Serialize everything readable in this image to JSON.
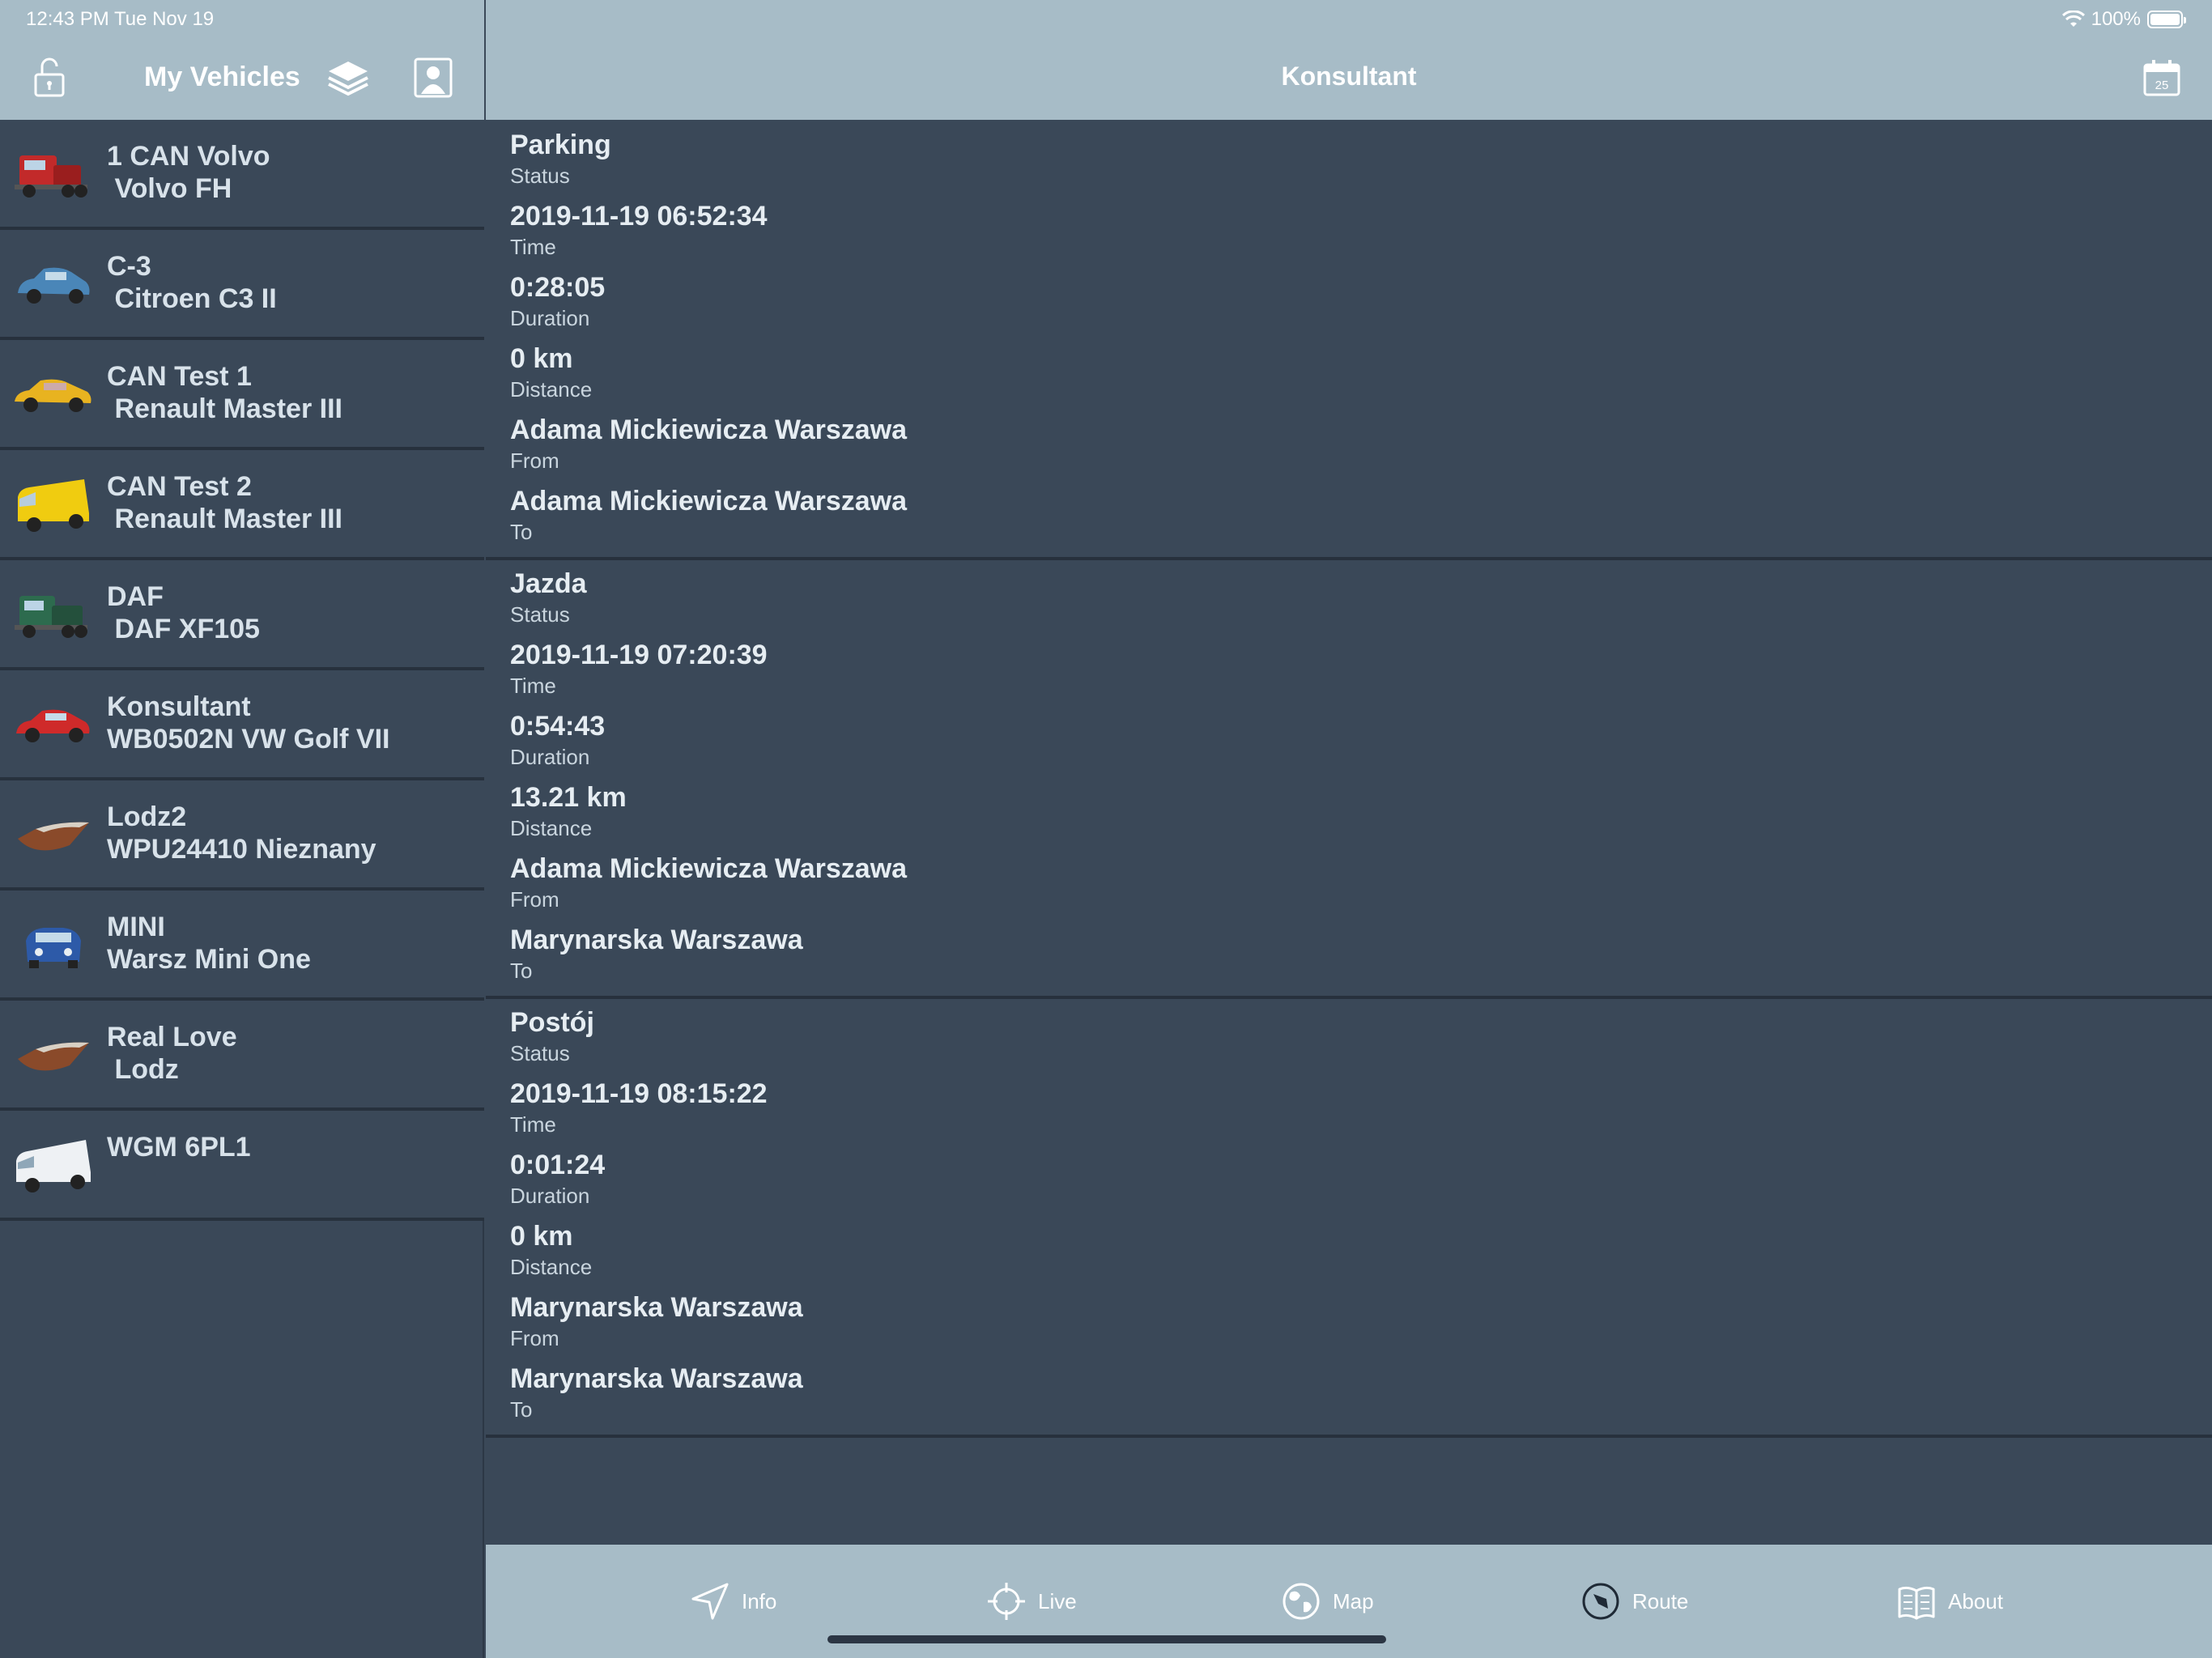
{
  "status_bar": {
    "time": "12:43 PM   Tue Nov 19",
    "battery": "100%"
  },
  "sidebar": {
    "title": "My Vehicles",
    "vehicles": [
      {
        "name": "1 CAN Volvo",
        "model": " Volvo FH",
        "icon": "red-truck-icon"
      },
      {
        "name": "C-3",
        "model": " Citroen C3 II",
        "icon": "blue-car-icon"
      },
      {
        "name": "CAN Test 1",
        "model": " Renault Master III",
        "icon": "yellow-taxi-icon"
      },
      {
        "name": "CAN Test 2",
        "model": " Renault Master III",
        "icon": "yellow-van-icon"
      },
      {
        "name": "DAF",
        "model": " DAF XF105",
        "icon": "green-truck-icon"
      },
      {
        "name": "Konsultant",
        "model": "WB0502N VW Golf VII",
        "icon": "red-car-icon"
      },
      {
        "name": "Lodz2",
        "model": "WPU24410 Nieznany",
        "icon": "boat-icon"
      },
      {
        "name": "MINI",
        "model": "Warsz Mini One",
        "icon": "mini-car-icon"
      },
      {
        "name": "Real Love",
        "model": " Lodz",
        "icon": "boat-icon"
      },
      {
        "name": "WGM 6PL1",
        "model": "",
        "icon": "white-van-icon"
      }
    ]
  },
  "main": {
    "title": "Konsultant",
    "events": [
      {
        "status": "Parking",
        "status_label": "Status",
        "time": "2019-11-19 06:52:34",
        "time_label": "Time",
        "duration": "0:28:05",
        "duration_label": "Duration",
        "distance": "0 km",
        "distance_label": "Distance",
        "from": "Adama Mickiewicza Warszawa",
        "from_label": "From",
        "to": "Adama Mickiewicza Warszawa",
        "to_label": "To"
      },
      {
        "status": "Jazda",
        "status_label": "Status",
        "time": "2019-11-19 07:20:39",
        "time_label": "Time",
        "duration": "0:54:43",
        "duration_label": "Duration",
        "distance": "13.21 km",
        "distance_label": "Distance",
        "from": "Adama Mickiewicza Warszawa",
        "from_label": "From",
        "to": "Marynarska Warszawa",
        "to_label": "To"
      },
      {
        "status": "Postój",
        "status_label": "Status",
        "time": "2019-11-19 08:15:22",
        "time_label": "Time",
        "duration": "0:01:24",
        "duration_label": "Duration",
        "distance": "0 km",
        "distance_label": "Distance",
        "from": "Marynarska Warszawa",
        "from_label": "From",
        "to": "Marynarska Warszawa",
        "to_label": "To"
      }
    ]
  },
  "tabbar": {
    "tabs": [
      {
        "label": "Info",
        "icon": "navigation-arrow-icon"
      },
      {
        "label": "Live",
        "icon": "crosshair-icon"
      },
      {
        "label": "Map",
        "icon": "globe-icon"
      },
      {
        "label": "Route",
        "icon": "compass-icon"
      },
      {
        "label": "About",
        "icon": "book-icon"
      }
    ]
  },
  "colors": {
    "header_bg": "#a7bcc7",
    "content_bg": "#3a4858",
    "divider": "#27313d",
    "text": "#e6edf2"
  }
}
